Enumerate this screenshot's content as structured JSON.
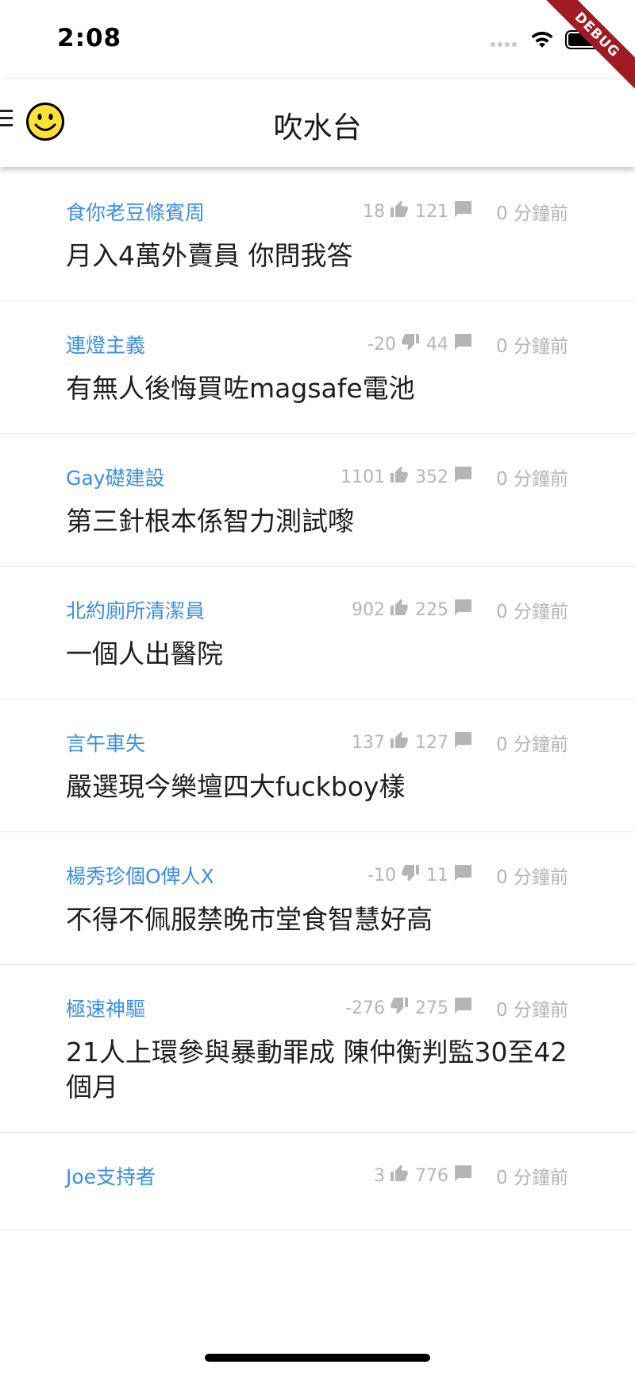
{
  "status_bar": {
    "time": "2:08"
  },
  "debug_banner": {
    "label": "DEBUG"
  },
  "app_bar": {
    "title": "吹水台"
  },
  "posts": [
    {
      "author": "食你老豆條賓周",
      "score": "18",
      "vote_icon": "thumbs-up-icon",
      "comments": "121",
      "time": "0 分鐘前",
      "title": "月入4萬外賣員 你問我答"
    },
    {
      "author": "連燈主義",
      "score": "-20",
      "vote_icon": "thumbs-down-icon",
      "comments": "44",
      "time": "0 分鐘前",
      "title": "有無人後悔買咗magsafe電池"
    },
    {
      "author": "Gay礎建設",
      "score": "1101",
      "vote_icon": "thumbs-up-icon",
      "comments": "352",
      "time": "0 分鐘前",
      "title": "第三針根本係智力測試嚟"
    },
    {
      "author": "北約廁所清潔員",
      "score": "902",
      "vote_icon": "thumbs-up-icon",
      "comments": "225",
      "time": "0 分鐘前",
      "title": "一個人出醫院"
    },
    {
      "author": "言午車失",
      "score": "137",
      "vote_icon": "thumbs-up-icon",
      "comments": "127",
      "time": "0 分鐘前",
      "title": "嚴選現今樂壇四大fuckboy樣"
    },
    {
      "author": "楊秀珍個O俾人X",
      "score": "-10",
      "vote_icon": "thumbs-down-icon",
      "comments": "11",
      "time": "0 分鐘前",
      "title": "不得不佩服禁晚市堂食智慧好高"
    },
    {
      "author": "極速神驅",
      "score": "-276",
      "vote_icon": "thumbs-down-icon",
      "comments": "275",
      "time": "0 分鐘前",
      "title": "21人上環參與暴動罪成 陳仲衡判監30至42個月"
    },
    {
      "author": "Joe支持者",
      "score": "3",
      "vote_icon": "thumbs-up-icon",
      "comments": "776",
      "time": "0 分鐘前",
      "title": ""
    }
  ],
  "colors": {
    "accent": "#3a8ee6",
    "meta_grey": "#b5b5b5",
    "debug_red": "#a01b22"
  }
}
